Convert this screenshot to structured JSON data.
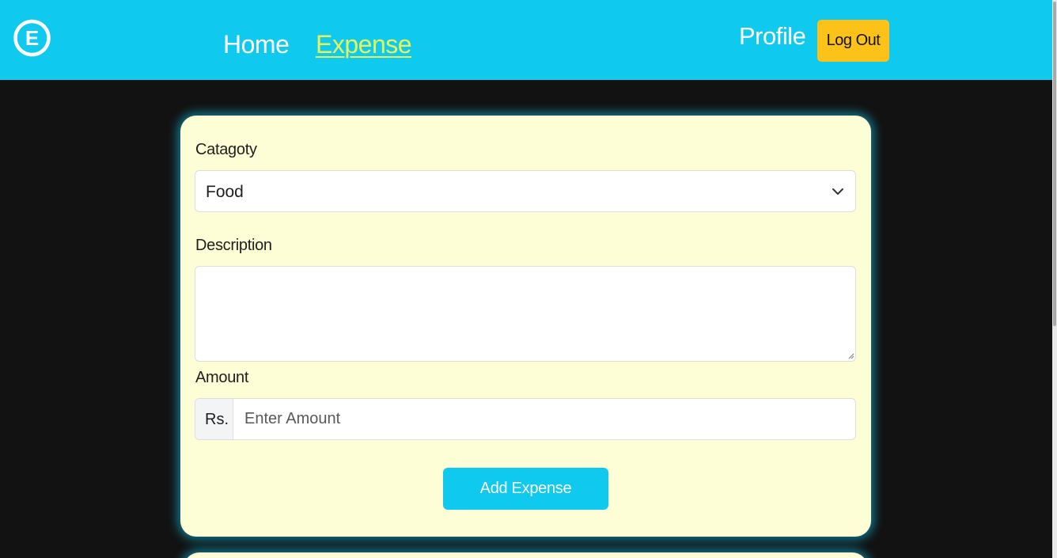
{
  "app": {
    "logo_letter": "E"
  },
  "nav": {
    "home_label": "Home",
    "expense_label": "Expense",
    "profile_label": "Profile",
    "logout_label": "Log Out"
  },
  "form": {
    "category": {
      "label": "Catagoty",
      "selected_value": "Food"
    },
    "description": {
      "label": "Description",
      "value": ""
    },
    "amount": {
      "label": "Amount",
      "prefix": "Rs.",
      "placeholder": "Enter Amount",
      "value": ""
    },
    "submit_label": "Add Expense"
  },
  "colors": {
    "navbar": "#10c9ee",
    "active_link": "#e6f55a",
    "logout_button": "#fdc21a",
    "card_background": "#fdfdd6",
    "page_background": "#121212",
    "primary_button": "#10c9ee"
  },
  "icons": {
    "logo": "circle-e-logo-icon",
    "select_caret": "chevron-down-icon",
    "textarea_resize": "resize-handle-icon"
  }
}
